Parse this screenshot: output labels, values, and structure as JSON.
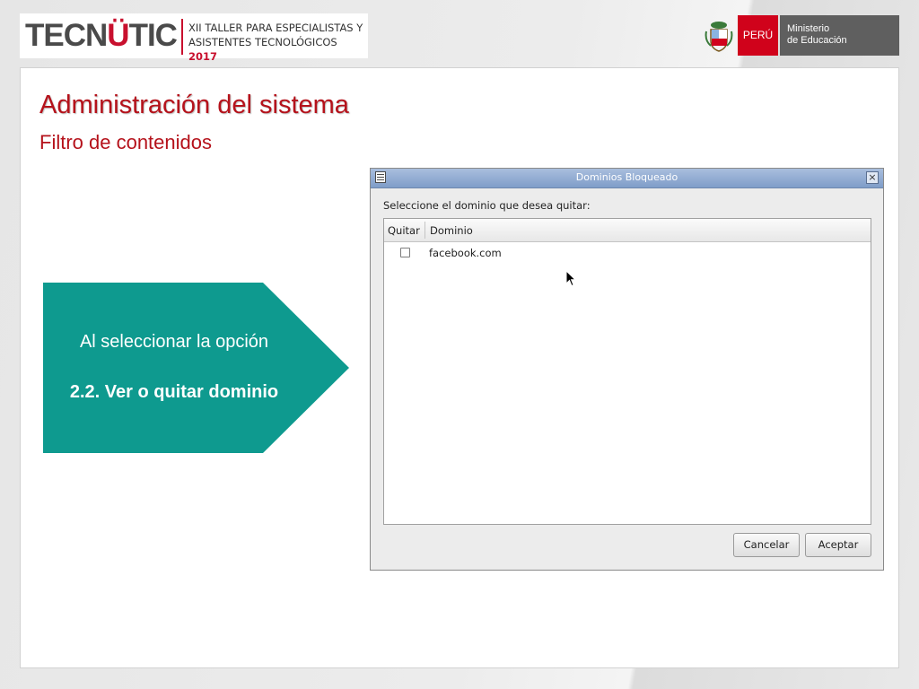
{
  "header": {
    "logo_text_a": "TECN",
    "logo_text_b": "Ü",
    "logo_text_c": "TIC",
    "event_line1": "XII TALLER PARA  ESPECIALISTAS  Y",
    "event_line2": "ASISTENTES TECNOLÓGICOS",
    "event_year": "2017",
    "country": "PERÚ",
    "ministry_line1": "Ministerio",
    "ministry_line2": "de Educación"
  },
  "slide": {
    "title": "Administración del sistema",
    "subtitle": "Filtro de contenidos"
  },
  "callout": {
    "line1": "Al seleccionar la opción",
    "line2": "2.2. Ver o quitar dominio",
    "color": "#0e9a8f"
  },
  "dialog": {
    "title": "Dominios Bloqueado",
    "close_glyph": "×",
    "prompt": "Seleccione el dominio que desea quitar:",
    "columns": [
      "Quitar",
      "Dominio"
    ],
    "rows": [
      {
        "checked": false,
        "domain": "facebook.com"
      }
    ],
    "cancel_label": "Cancelar",
    "accept_label": "Aceptar"
  },
  "colors": {
    "title_red": "#b5121b",
    "brand_red": "#d0021b",
    "titlebar_blue": "#8fa9d2"
  },
  "icons": {
    "window_menu": "window-menu-icon",
    "close": "close-icon",
    "cursor": "mouse-cursor-icon",
    "shield": "coat-of-arms-icon"
  }
}
